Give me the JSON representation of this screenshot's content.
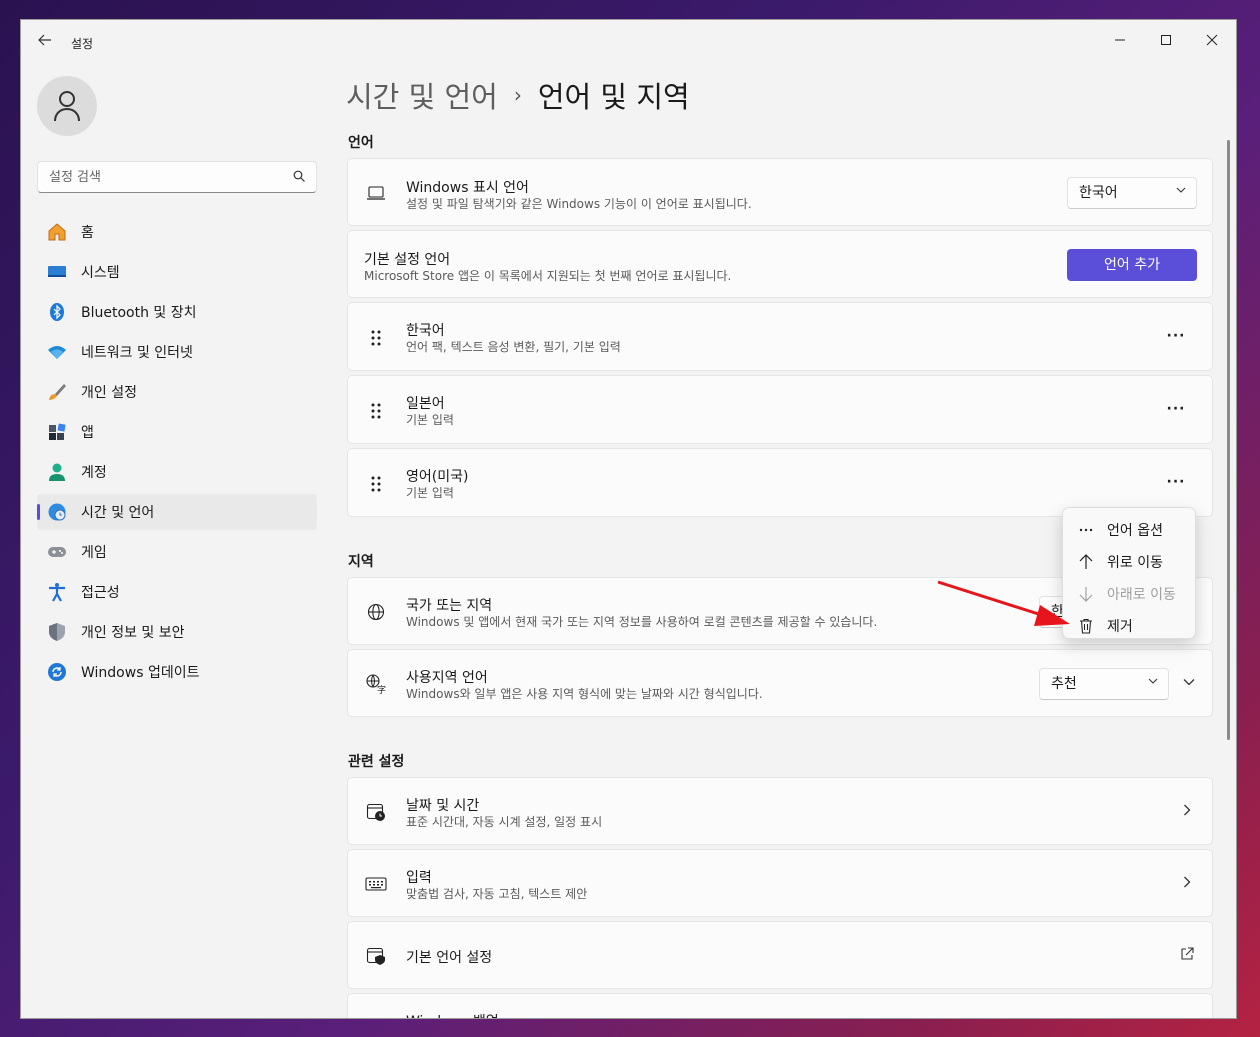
{
  "window": {
    "app_title": "설정"
  },
  "search": {
    "placeholder": "설정 검색"
  },
  "sidebar": {
    "items": [
      {
        "label": "홈"
      },
      {
        "label": "시스템"
      },
      {
        "label": "Bluetooth 및 장치"
      },
      {
        "label": "네트워크 및 인터넷"
      },
      {
        "label": "개인 설정"
      },
      {
        "label": "앱"
      },
      {
        "label": "계정"
      },
      {
        "label": "시간 및 언어",
        "active": true
      },
      {
        "label": "게임"
      },
      {
        "label": "접근성"
      },
      {
        "label": "개인 정보 및 보안"
      },
      {
        "label": "Windows 업데이트"
      }
    ]
  },
  "breadcrumb": {
    "parent": "시간 및 언어",
    "separator": "›",
    "current": "언어 및 지역"
  },
  "language_section": {
    "title": "언어",
    "display_language": {
      "title": "Windows 표시 언어",
      "subtitle": "설정 및 파일 탐색기와 같은 Windows 기능이 이 언어로 표시됩니다.",
      "value": "한국어"
    },
    "preferred": {
      "title": "기본 설정 언어",
      "subtitle": "Microsoft Store 앱은 이 목록에서 지원되는 첫 번째 언어로 표시됩니다.",
      "button": "언어 추가"
    },
    "languages": [
      {
        "name": "한국어",
        "features": "언어 팩, 텍스트 음성 변환, 필기, 기본 입력"
      },
      {
        "name": "일본어",
        "features": "기본 입력"
      },
      {
        "name": "영어(미국)",
        "features": "기본 입력"
      }
    ],
    "more_glyph": "···"
  },
  "region_section": {
    "title": "지역",
    "country": {
      "title": "국가 또는 지역",
      "subtitle": "Windows 및 앱에서 현재 국가 또는 지역 정보를 사용하여 로컬 콘텐츠를 제공할 수 있습니다.",
      "value": "한"
    },
    "regional_format": {
      "title": "사용지역 언어",
      "subtitle": "Windows와 일부 앱은 사용 지역 형식에 맞는 날짜와 시간 형식입니다.",
      "value": "추천"
    }
  },
  "related_section": {
    "title": "관련 설정",
    "items": [
      {
        "title": "날짜 및 시간",
        "subtitle": "표준 시간대, 자동 시계 설정, 일정 표시"
      },
      {
        "title": "입력",
        "subtitle": "맞춤법 검사, 자동 고침, 텍스트 제안"
      },
      {
        "title": "기본 언어 설정",
        "subtitle": ""
      },
      {
        "title": "Windows 백업",
        "subtitle": ""
      }
    ]
  },
  "context_menu": {
    "items": [
      {
        "label": "언어 옵션",
        "icon": "more-icon",
        "disabled": false
      },
      {
        "label": "위로 이동",
        "icon": "arrow-up-icon",
        "disabled": false
      },
      {
        "label": "아래로 이동",
        "icon": "arrow-down-icon",
        "disabled": true
      },
      {
        "label": "제거",
        "icon": "trash-icon",
        "disabled": false
      }
    ]
  },
  "colors": {
    "accent": "#5b4fd9",
    "annotation_arrow": "#e8141b"
  }
}
